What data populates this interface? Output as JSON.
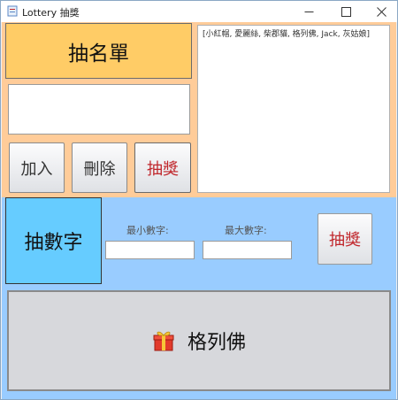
{
  "window": {
    "title": "Lottery 抽獎"
  },
  "list_section": {
    "heading": "抽名單",
    "name_input_value": "",
    "buttons": {
      "add": "加入",
      "delete": "刪除",
      "draw": "抽獎"
    },
    "list_text": "[小紅帽, 愛麗絲, 柴郡貓, 格列佛, Jack, 灰姑娘]"
  },
  "number_section": {
    "heading": "抽數字",
    "min_label": "最小數字:",
    "max_label": "最大數字:",
    "min_value": "",
    "max_value": "",
    "draw": "抽獎"
  },
  "result": {
    "text": "格列佛",
    "icon": "gift-icon"
  },
  "colors": {
    "list_panel": "#ffcc99",
    "number_panel": "#99ccff",
    "list_heading_bg": "#ffcc66",
    "number_heading_bg": "#66ccff",
    "draw_text": "#c0262b"
  }
}
